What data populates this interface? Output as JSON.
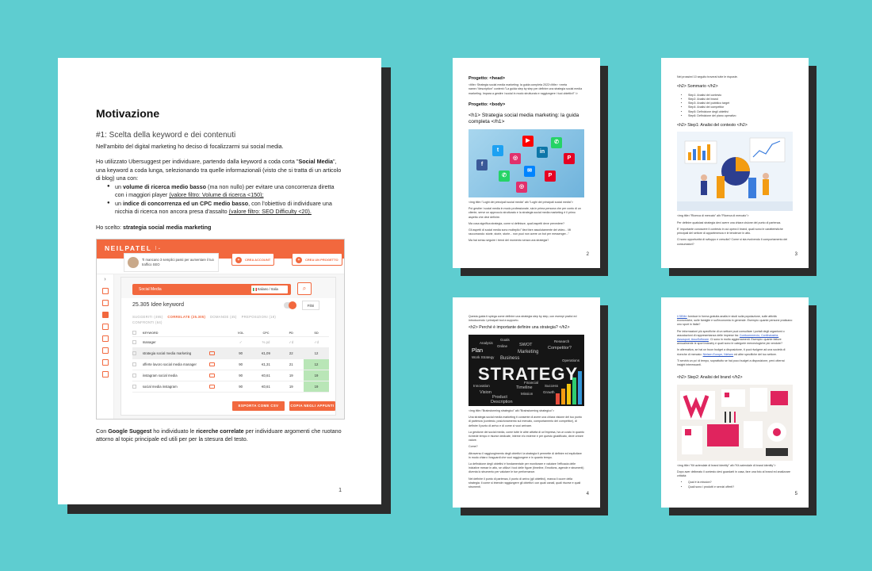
{
  "page1": {
    "title": "Motivazione",
    "section": "#1:  Scelta della keyword e dei contenuti",
    "para1": "Nell'ambito del digital marketing ho deciso di focalizzarmi sui social media.",
    "para2_a": "Ho utilizzato Ubersuggest per individuare, partendo dalla keyword a coda corta \"",
    "para2_b": "Social Media",
    "para2_c": "\", una keyword a coda lunga, selezionando tra quelle informazionali (visto che si tratta di un articolo di blog) una con:",
    "bullet1_a": "un ",
    "bullet1_b": "volume di ricerca medio basso",
    "bullet1_c": " (ma non nullo) per evitare una concorrenza diretta con i maggiori player ",
    "bullet1_d": "(valore filtro: Volume di ricerca <150);",
    "bullet2_a": "un ",
    "bullet2_b": "indice di concorrenza ed un CPC medio basso",
    "bullet2_c": ", con l'obiettivo di individuare una nicchia di ricerca non ancora presa d'assalto ",
    "bullet2_d": "(valore filtro: SEO Difficulty <20).",
    "chosen_a": "Ho scelto: ",
    "chosen_b": "strategia social media marketing",
    "closing_a": "Con ",
    "closing_b": "Google Suggest",
    "closing_c": " ho individuato le ",
    "closing_d": "ricerche correlate",
    "closing_e": " per individuare argomenti che ruotano attorno al topic principale ed utili per per la stesura del testo.",
    "page_number": "1"
  },
  "ubersuggest": {
    "logo": "NEILPATEL",
    "logo_dropdown": "|  ⌄",
    "promo": "Ti mancano 3 semplici passi per aumentare il tuo traffico SEO",
    "btn_account": "CREA ACCOUNT",
    "btn_project": "CREA UN PROGETTO",
    "search_value": "Social Media",
    "language": "Italiano / Italia",
    "keyword_count": "25.305 Idee keyword",
    "filters": "Filtri",
    "tabs_line1": [
      "SUGGERITI (495)",
      "CORRELATE (25.305)",
      "DOMANDE (45)",
      "PREPOSIZIONI (19)"
    ],
    "tabs_line2": "CONFRONTI (64)",
    "columns": [
      "KEYWORD",
      "VOL",
      "CPC",
      "PD",
      "SD"
    ],
    "column_icons": [
      "",
      "✓",
      "% pd",
      "✓d",
      "✓d"
    ],
    "rows": [
      {
        "kw": "manager",
        "vol": "",
        "cpc": "",
        "pd": "",
        "sd": ""
      },
      {
        "kw": "strategia social media marketing",
        "vol": "90",
        "cpc": "€1,09",
        "pd": "22",
        "sd": "12"
      },
      {
        "kw": "offerte lavoro social media manager",
        "vol": "90",
        "cpc": "€1,31",
        "pd": "21",
        "sd": "12"
      },
      {
        "kw": "instagram social media",
        "vol": "90",
        "cpc": "€0,61",
        "pd": "19",
        "sd": "19"
      },
      {
        "kw": "social media instagram",
        "vol": "90",
        "cpc": "€0,61",
        "pd": "19",
        "sd": "19"
      }
    ],
    "btn_csv": "ESPORTA COME CSV",
    "btn_copy": "COPIA NEGLI APPUNTI"
  },
  "page2": {
    "h_head": "Progetto: <head>",
    "head_text": "<title> Strategia social media marketing: la guida completa 2022</title> <meta name=\"description\" content=\"La guida step by step per definire una strategia social media marketing. Impara a gestire i social in modo strutturato e raggiungere i tuoi obiettivi!\" />",
    "h_body": "Progetto: <body>",
    "h1": "<h1> Strategia social media marketing: la guida completa </h1>",
    "img_caption": "<img title=\"Loghi dei principali social media\" alt=\"Loghi dei principali social media\">",
    "p1": "Poi gestire i social media in modo professionale, sia in prima persona che per conto di un cliente, serve un approccio strutturato e la strategia social media marketing è il primo aspetto che devi definire.",
    "p2": "Ma cosa significa strategia, come si definisce, quali aspetti deve prevedere?",
    "p3": "Gli aspetti di social media sono molteplici \"devi fare assolutamente dei video... Mi raccomando: storie, storie, storie... non puoi non avere un bot per messenger...\"",
    "p4": "Ma hai senso seguire i trend del momento senza una strategia?",
    "page_number": "2"
  },
  "page3": {
    "intro": "Nel prossimi 10 seguito troverai tutte le risposte.",
    "h2_summary": "<h2> Sommario </h2>",
    "steps": [
      "Step1: Analisi del contesto",
      "Step2: Analisi del brand",
      "Step3: Analisi del pubblico target",
      "Step4: Analisi dei competitor",
      "Step5: Definizione degli obiettivi",
      "Step6: Definizione del piano operativo"
    ],
    "h2_step1": "<h2>  Step1: Analisi del contesto </h2>",
    "img_caption": "<img title=\"Ricerca di mercato\" alt=\"Ricerca di mercato\">",
    "p1": "Per definire qualsiasi strategia devi avere una chiara visione del punto di partenza.",
    "p2": "E' importante conoscere il contesto in cui opera il brand, quali sono le caratteristiche principali del settore di appartenenza e le tendenze in atto.",
    "p3": "Ci sono opportunità di sviluppo e crescita? Come si sta evolvendo il comportamento dei consumatori?",
    "page_number": "3"
  },
  "page4": {
    "intro": "Questa guida ti spiega come definire una strategia step by step, con esempi pratici ed introducendo i principali tool a supporto.",
    "h2": "<h2> Perché è importante definire una strategia? </h2>",
    "strategy_word": "STRATEGY",
    "strategy_words": [
      "Goals",
      "Analysis",
      "Online",
      "SWOT",
      "Plan",
      "Marketing",
      "Business",
      "Work Strategy",
      "Research",
      "Competitor?",
      "Operations",
      "Financial",
      "Success",
      "Timeline",
      "Growth",
      "Mission",
      "Innovation",
      "Vision",
      "Product",
      "Description"
    ],
    "img_caption": "<img title=\"Brainstorming strategico\" alt=\"Brainstorming strategico\">",
    "p1": "Una strategia social media marketing ti consente di avere una chiara visione del tuo punto di partenza (contesto, posizionamento sul mercato, comportamento dei competitor), di definire il punto di arrivo e di come ci vuoi arrivare.",
    "p2": "La gestione dei social media, come tutte le altre attività di un'impresa, ha un costo in quanto richiede tempo e risorse dedicate, interne e/o esterne e per questo giustificato, deve creare valore.",
    "p3": "Come?",
    "p4": "Attraverso il raggiungimento degli obiettivi: la strategia ti permette di definire ed esplicitare in modo chiaro i traguardi che vuoi raggiungere e in quanto tempo.",
    "p5": "La definizione degli obiettivi è fondamentale per monitorare e valutare l'efficacia delle iniziative messe in atto, se utilizzi i tool delle figure (timeline, Emotions, agende e strumenti) diventa lo strumento per valutare le tue performance.",
    "p6": "Nel definire il punto di partenza, il punto di arrivo (gli obiettivi), manca il cuore della strategia: il come si intende raggiungere gli obiettivi: con quali canali, quali risorse e quali strumenti.",
    "page_number": "4"
  },
  "page5": {
    "p1_link": "il SEMrr",
    "p1": " fornisce in forma gratuita analisi e studi sulla popolazione, sulle attività economiche, sulle famiglie e sull'economia in generale. Esempio: quante persone praticano uno sport in Italia?",
    "p2": "Per informazioni più specifiche di un settore puoi consultare i portali degli organismi o associazioni di rappresentanza delle imprese tra: ",
    "p2_links": "Confcommercio, Confindustria, Assosport, AssoSoftware",
    "p2_end": ". Ci sono in molto aggiornamenti. Esempio: quante fatture annualmente le sport industry e quali sono le categorie merceologiche più vendute?",
    "p3": "In alternativa, se hai un buon budget a disposizione, ti puoi rivolgere ad una società di ricerche di mercato: ",
    "p3_links": "Nielsen Europe, Nielsen",
    "p3_end": " ed altre specifiche del tuo settore.",
    "p4": "Ti servirà un po' di tempo, soprattutto se hai poco budget a disposizione, però otterrai insight interessanti.",
    "h2": "<h2>  Step2: Analisi del brand </h2>",
    "img_caption": "<img title=\"Kit aziendale di brand identity\" alt=\"Kit aziendale di brand identity\">",
    "p5": "Dopo aver delineato il contesto devi guardarti in casa, fare una foto al brand ed analizzare criticità:",
    "bullets": [
      "Qual è la mission?",
      "Quali sono i prodotti e servizi offerti?"
    ],
    "page_number": "5"
  },
  "colors": {
    "background": "#5ecdd0",
    "accent": "#f2683e",
    "highlight_green": "#b9e6b7"
  }
}
